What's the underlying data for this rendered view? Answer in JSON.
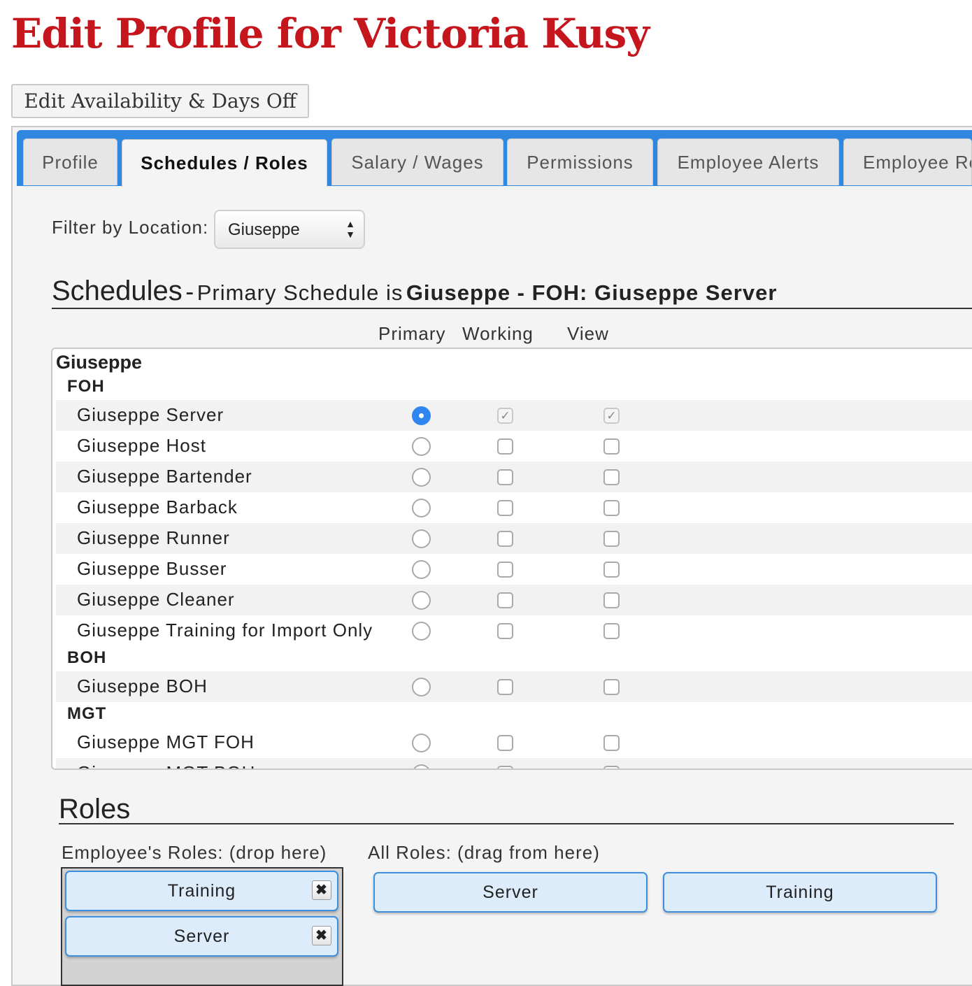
{
  "page": {
    "title": "Edit Profile for Victoria Kusy",
    "availability_button": "Edit Availability & Days Off"
  },
  "tabs": [
    {
      "label": "Profile",
      "active": false
    },
    {
      "label": "Schedules / Roles",
      "active": true
    },
    {
      "label": "Salary / Wages",
      "active": false
    },
    {
      "label": "Permissions",
      "active": false
    },
    {
      "label": "Employee Alerts",
      "active": false
    },
    {
      "label": "Employee Re",
      "active": false
    }
  ],
  "filter": {
    "label": "Filter by Location:",
    "selected": "Giuseppe"
  },
  "schedules": {
    "heading": "Schedules",
    "separator": "-",
    "primary_prefix": "Primary Schedule is",
    "primary_value": "Giuseppe - FOH: Giuseppe Server",
    "columns": [
      "Primary",
      "Working",
      "View"
    ],
    "location": "Giuseppe",
    "groups": [
      {
        "name": "FOH"
      },
      {
        "name": "BOH"
      },
      {
        "name": "MGT"
      }
    ],
    "rows": [
      {
        "label": "Giuseppe Server",
        "primary": true,
        "working": true,
        "view": true
      },
      {
        "label": "Giuseppe Host",
        "primary": false,
        "working": false,
        "view": false
      },
      {
        "label": "Giuseppe Bartender",
        "primary": false,
        "working": false,
        "view": false
      },
      {
        "label": "Giuseppe Barback",
        "primary": false,
        "working": false,
        "view": false
      },
      {
        "label": "Giuseppe Runner",
        "primary": false,
        "working": false,
        "view": false
      },
      {
        "label": "Giuseppe Busser",
        "primary": false,
        "working": false,
        "view": false
      },
      {
        "label": "Giuseppe Cleaner",
        "primary": false,
        "working": false,
        "view": false
      },
      {
        "label": "Giuseppe Training for Import Only",
        "primary": false,
        "working": false,
        "view": false
      },
      {
        "label": "Giuseppe BOH",
        "primary": false,
        "working": false,
        "view": false
      },
      {
        "label": "Giuseppe MGT FOH",
        "primary": false,
        "working": false,
        "view": false
      },
      {
        "label": "Giuseppe MGT BOH",
        "primary": false,
        "working": false,
        "view": false
      }
    ],
    "check_glyph": "✓"
  },
  "roles": {
    "heading": "Roles",
    "employee_label": "Employee's Roles: (drop here)",
    "all_label": "All Roles: (drag from here)",
    "employee_roles": [
      "Training",
      "Server"
    ],
    "all_roles": [
      "Server",
      "Training"
    ],
    "remove_glyph": "✖"
  },
  "colors": {
    "title": "#c4161c",
    "tab_bar": "#2f87e0",
    "radio_selected": "#2f86f0",
    "role_pill_bg": "#dcecfb",
    "role_pill_border": "#3d8fe0"
  }
}
